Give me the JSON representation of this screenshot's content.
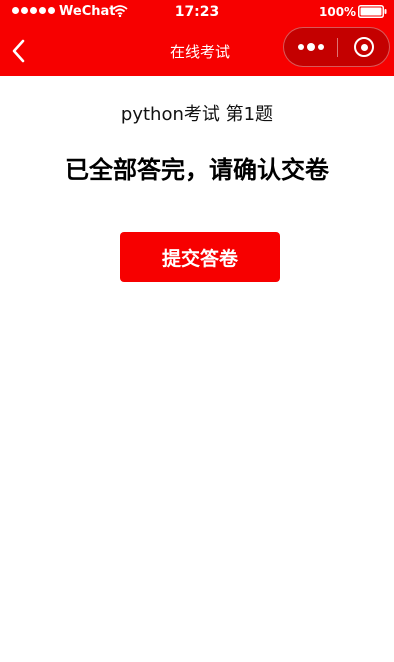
{
  "status_bar": {
    "carrier": "WeChat",
    "time": "17:23",
    "battery": "100%"
  },
  "nav": {
    "title": "在线考试"
  },
  "main": {
    "exam_info": "python考试 第1题",
    "completion_message": "已全部答完，请确认交卷",
    "submit_label": "提交答卷"
  },
  "colors": {
    "accent": "#f70000",
    "capsule": "#c40000"
  }
}
